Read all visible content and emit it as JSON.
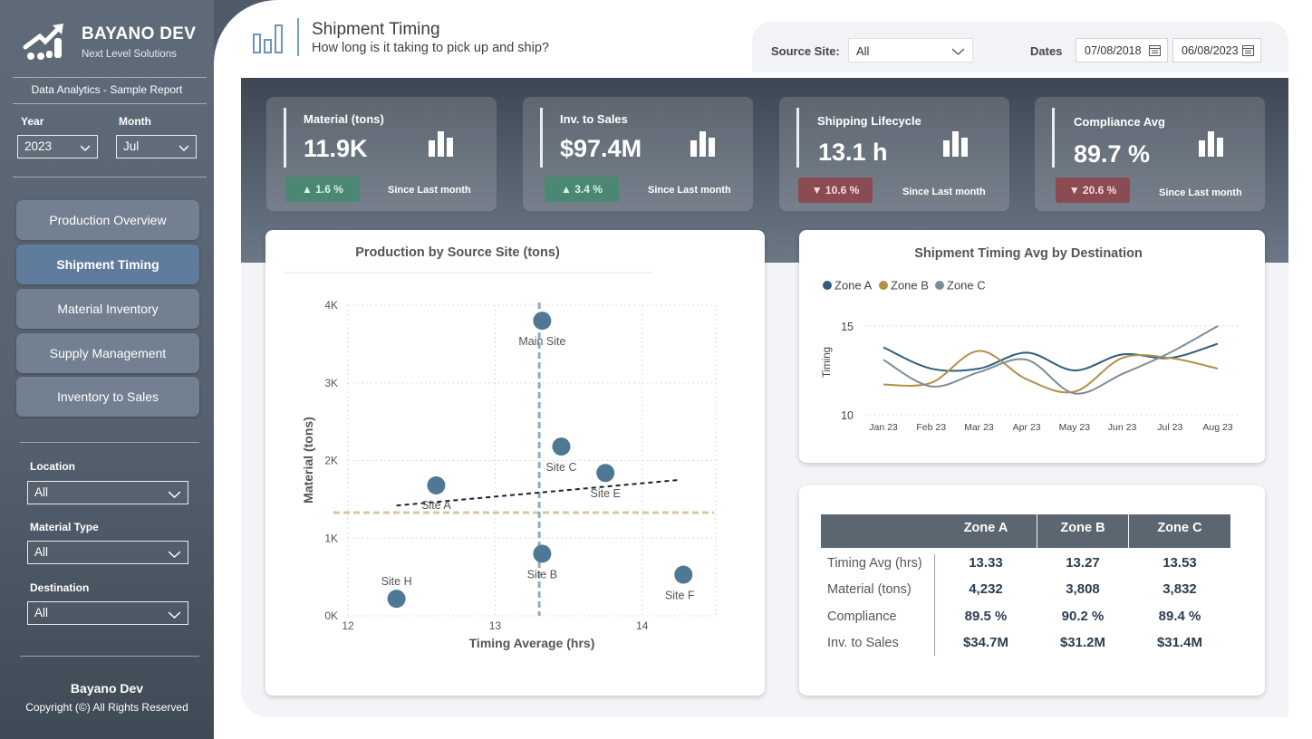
{
  "sidebar": {
    "brand": "BAYANO DEV",
    "tagline": "Next Level Solutions",
    "report_label": "Data Analytics - Sample Report",
    "year_label": "Year",
    "year_value": "2023",
    "month_label": "Month",
    "month_value": "Jul",
    "nav": [
      {
        "label": "Production Overview",
        "active": false
      },
      {
        "label": "Shipment Timing",
        "active": true
      },
      {
        "label": "Material Inventory",
        "active": false
      },
      {
        "label": "Supply Management",
        "active": false
      },
      {
        "label": "Inventory to Sales",
        "active": false
      }
    ],
    "filters": [
      {
        "label": "Location",
        "value": "All"
      },
      {
        "label": "Material Type",
        "value": "All"
      },
      {
        "label": "Destination",
        "value": "All"
      }
    ],
    "footer_name": "Bayano Dev",
    "footer_copy": "Copyright (©) All Rights Reserved"
  },
  "header": {
    "title": "Shipment Timing",
    "subtitle": "How long is it taking to pick up and ship?",
    "source_site_label": "Source Site:",
    "source_site_value": "All",
    "dates_label": "Dates",
    "date_start": "07/08/2018",
    "date_end": "06/08/2023"
  },
  "kpis": [
    {
      "title": "Material (tons)",
      "value": "11.9K",
      "delta": "▲ 1.6 %",
      "direction": "up",
      "since": "Since Last month"
    },
    {
      "title": "Inv. to Sales",
      "value": "$97.4M",
      "delta": "▲ 3.4 %",
      "direction": "up",
      "since": "Since Last month"
    },
    {
      "title": "Shipping Lifecycle",
      "value": "13.1 h",
      "delta": "▼ 10.6 %",
      "direction": "down",
      "since": "Since Last month"
    },
    {
      "title": "Compliance Avg",
      "value": "89.7 %",
      "delta": "▼ 20.6 %",
      "direction": "down",
      "since": "Since Last month"
    }
  ],
  "colors": {
    "accent": "#4f7894",
    "zone_a": "#2f5d7a",
    "zone_b": "#b38f4a",
    "zone_c": "#7f8c96",
    "kpi_up": "#4a8874",
    "kpi_down": "#8a4b52"
  },
  "chart_data": [
    {
      "type": "scatter",
      "title": "Production by Source Site (tons)",
      "xlabel": "Timing Average (hrs)",
      "ylabel": "Material (tons)",
      "xlim": [
        12,
        14.5
      ],
      "ylim": [
        0,
        4000
      ],
      "x_ticks": [
        "12",
        "13",
        "14"
      ],
      "x_tick_values": [
        12,
        13,
        14
      ],
      "y_ticks": [
        "0K",
        "1K",
        "2K",
        "3K",
        "4K"
      ],
      "y_tick_values": [
        0,
        1000,
        2000,
        3000,
        4000
      ],
      "points": [
        {
          "label": "Main Site",
          "x": 13.32,
          "y": 3800
        },
        {
          "label": "Site A",
          "x": 12.6,
          "y": 1680
        },
        {
          "label": "Site B",
          "x": 13.32,
          "y": 800
        },
        {
          "label": "Site C",
          "x": 13.45,
          "y": 2180
        },
        {
          "label": "Site E",
          "x": 13.75,
          "y": 1840
        },
        {
          "label": "Site F",
          "x": 14.28,
          "y": 530
        },
        {
          "label": "Site H",
          "x": 12.33,
          "y": 220
        }
      ],
      "reference_lines": {
        "x_avg": 13.3,
        "y_avg": 1330
      },
      "trend": {
        "x": [
          12.33,
          14.25
        ],
        "y": [
          1420,
          1750
        ]
      },
      "grid": true
    },
    {
      "type": "line",
      "title": "Shipment Timing Avg by Destination",
      "xlabel": "",
      "ylabel": "Timing",
      "categories": [
        "Jan 23",
        "Feb 23",
        "Mar 23",
        "Apr 23",
        "May 23",
        "Jun 23",
        "Jul 23",
        "Aug 23"
      ],
      "ylim": [
        10,
        15
      ],
      "y_ticks": [
        "10",
        "15"
      ],
      "y_tick_values": [
        10,
        15
      ],
      "series": [
        {
          "name": "Zone A",
          "values": [
            13.8,
            12.6,
            12.6,
            13.5,
            12.5,
            13.4,
            13.2,
            14.0
          ]
        },
        {
          "name": "Zone B",
          "values": [
            11.7,
            11.8,
            13.6,
            12.0,
            11.3,
            13.2,
            13.2,
            12.6
          ]
        },
        {
          "name": "Zone C",
          "values": [
            13.1,
            11.6,
            12.4,
            13.1,
            11.2,
            12.3,
            13.5,
            15.0
          ]
        }
      ],
      "legend": "top-left",
      "grid": true
    }
  ],
  "table": {
    "columns": [
      "",
      "Zone A",
      "Zone B",
      "Zone C"
    ],
    "rows": [
      {
        "label": "Timing Avg (hrs)",
        "values": [
          "13.33",
          "13.27",
          "13.53"
        ]
      },
      {
        "label": "Material (tons)",
        "values": [
          "4,232",
          "3,808",
          "3,832"
        ]
      },
      {
        "label": "Compliance",
        "values": [
          "89.5 %",
          "90.2 %",
          "89.4 %"
        ]
      },
      {
        "label": "Inv. to Sales",
        "values": [
          "$34.7M",
          "$31.2M",
          "$31.4M"
        ]
      }
    ]
  }
}
